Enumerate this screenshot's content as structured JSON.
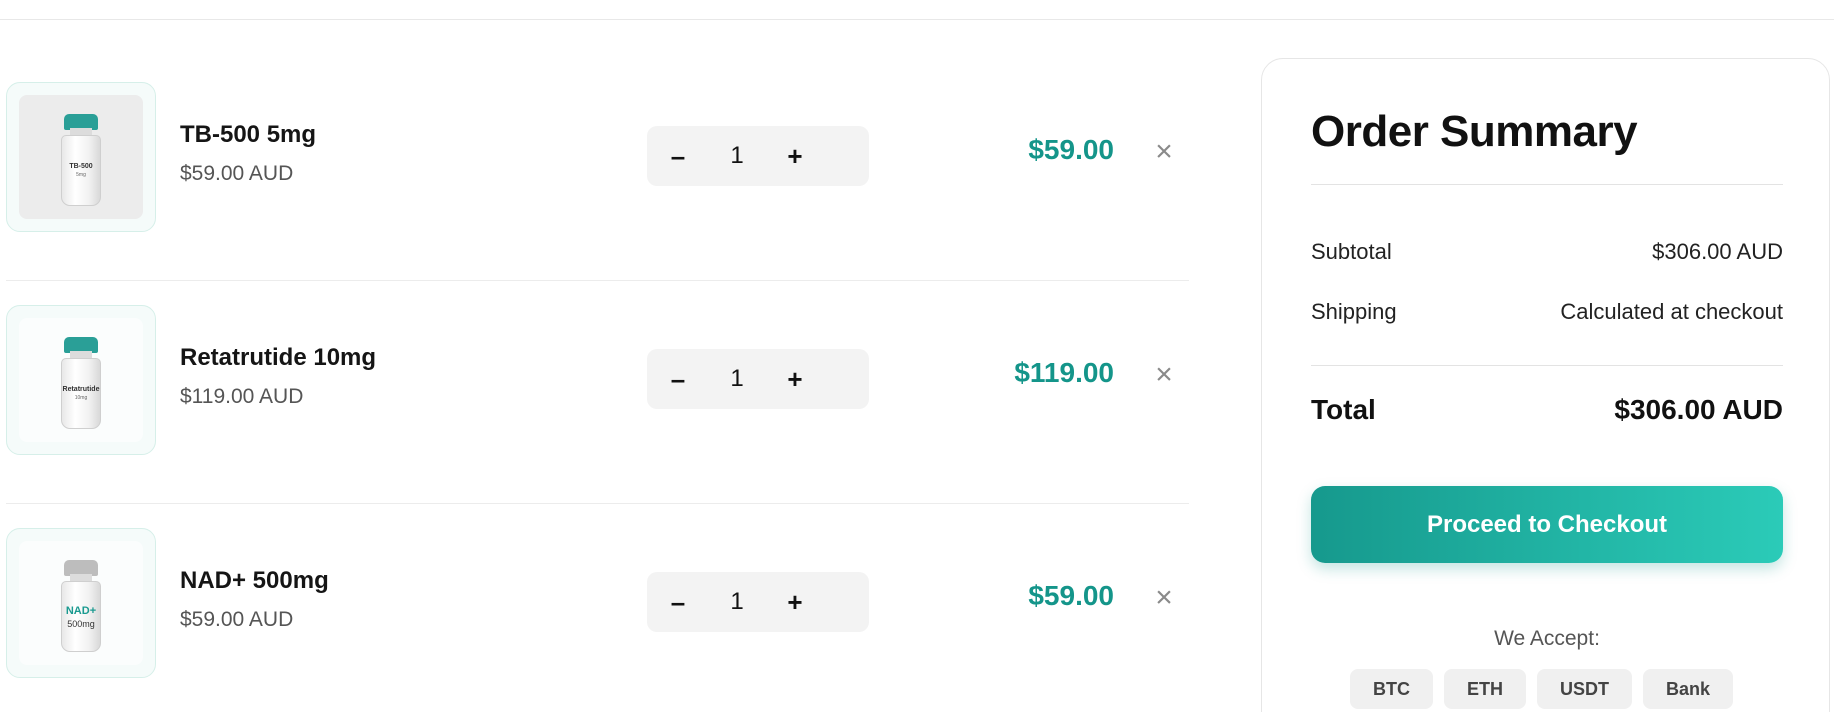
{
  "cart": {
    "items": [
      {
        "name": "TB-500 5mg",
        "unit_price": "$59.00 AUD",
        "quantity": "1",
        "line_total": "$59.00",
        "decrease_label": "–",
        "increase_label": "+",
        "remove_label": "×",
        "vial_label": "TB-500",
        "vial_sublabel": "5mg"
      },
      {
        "name": "Retatrutide 10mg",
        "unit_price": "$119.00 AUD",
        "quantity": "1",
        "line_total": "$119.00",
        "decrease_label": "–",
        "increase_label": "+",
        "remove_label": "×",
        "vial_label": "Retatrutide",
        "vial_sublabel": "10mg"
      },
      {
        "name": "NAD+ 500mg",
        "unit_price": "$59.00 AUD",
        "quantity": "1",
        "line_total": "$59.00",
        "decrease_label": "–",
        "increase_label": "+",
        "remove_label": "×",
        "vial_label": "NAD+",
        "vial_sublabel": "500mg"
      }
    ]
  },
  "summary": {
    "title": "Order Summary",
    "subtotal_label": "Subtotal",
    "subtotal_value": "$306.00 AUD",
    "shipping_label": "Shipping",
    "shipping_value": "Calculated at checkout",
    "total_label": "Total",
    "total_value": "$306.00 AUD",
    "checkout_label": "Proceed to Checkout",
    "accept_label": "We Accept:",
    "payment_methods": [
      "BTC",
      "ETH",
      "USDT",
      "Bank"
    ]
  },
  "colors": {
    "accent": "#14958a",
    "button_gradient_start": "#16998d",
    "button_gradient_end": "#2bcbb8",
    "teal_cap": "#2a9f97",
    "silver_cap": "#bdbdbd"
  },
  "icons": {
    "remove": "close-icon",
    "decrease": "minus-icon",
    "increase": "plus-icon"
  }
}
